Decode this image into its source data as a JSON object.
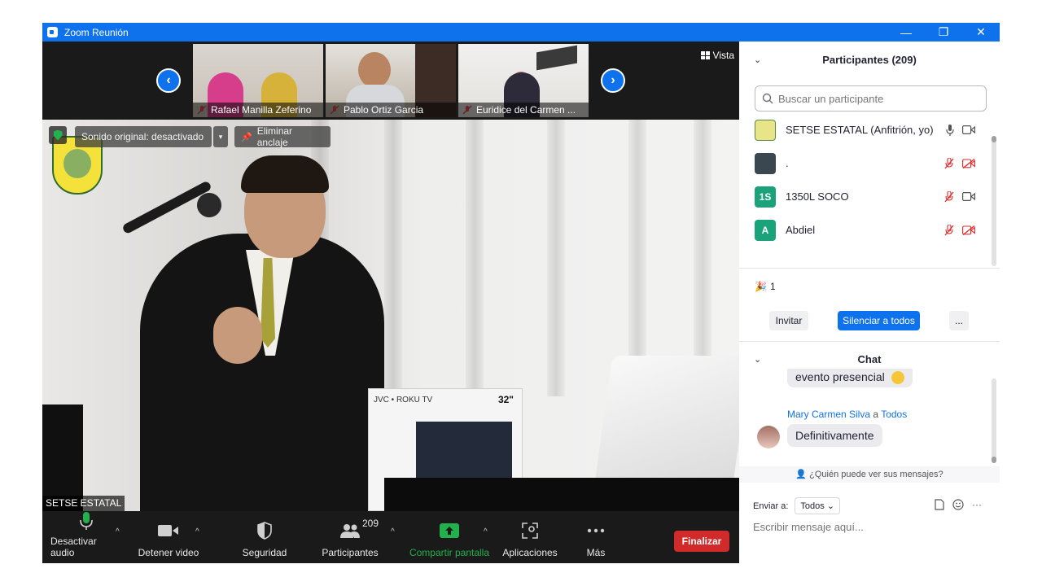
{
  "window": {
    "title": "Zoom Reunión"
  },
  "gallery": {
    "thumbnails": [
      {
        "name": "Rafael Manilla Zeferino"
      },
      {
        "name": "Pablo Ortiz Garcia"
      },
      {
        "name": "Euridice del Carmen ..."
      }
    ],
    "view_label": "Vista"
  },
  "main_video": {
    "original_sound": "Sonido original: desactivado",
    "unpin": "Eliminar anclaje",
    "speaker": "SETSE ESTATAL",
    "tv_brand": "JVC • ROKU TV",
    "tv_size": "32\""
  },
  "toolbar": {
    "mute": "Desactivar audio",
    "video": "Detener video",
    "security": "Seguridad",
    "participants": "Participantes",
    "participants_count": "209",
    "share": "Compartir pantalla",
    "apps": "Aplicaciones",
    "more": "Más",
    "end": "Finalizar"
  },
  "participants_panel": {
    "title": "Participantes (209)",
    "search_placeholder": "Buscar un participante",
    "list": [
      {
        "name": "SETSE ESTATAL (Anfitrión, yo)",
        "initials": "",
        "color": "#e8e48a"
      },
      {
        "name": ".",
        "initials": "",
        "color": "#3a4650"
      },
      {
        "name": "1350L SOCO",
        "initials": "1S",
        "color": "#1aa37a"
      },
      {
        "name": "Abdiel",
        "initials": "A",
        "color": "#1aa37a"
      }
    ],
    "reaction_count": "1",
    "invite": "Invitar",
    "mute_all": "Silenciar a todos",
    "more": "..."
  },
  "chat_panel": {
    "title": "Chat",
    "prev_message": "evento presencial",
    "sender": "Mary Carmen Silva",
    "to_word": "a",
    "recipient": "Todos",
    "message": "Definitivamente",
    "who_can_see": "¿Quién puede ver sus mensajes?",
    "send_to_label": "Enviar a:",
    "send_to_value": "Todos",
    "input_placeholder": "Escribir mensaje aquí..."
  },
  "colors": {
    "accent": "#0e72ed",
    "end": "#d12a2a",
    "share": "#22b14c"
  }
}
